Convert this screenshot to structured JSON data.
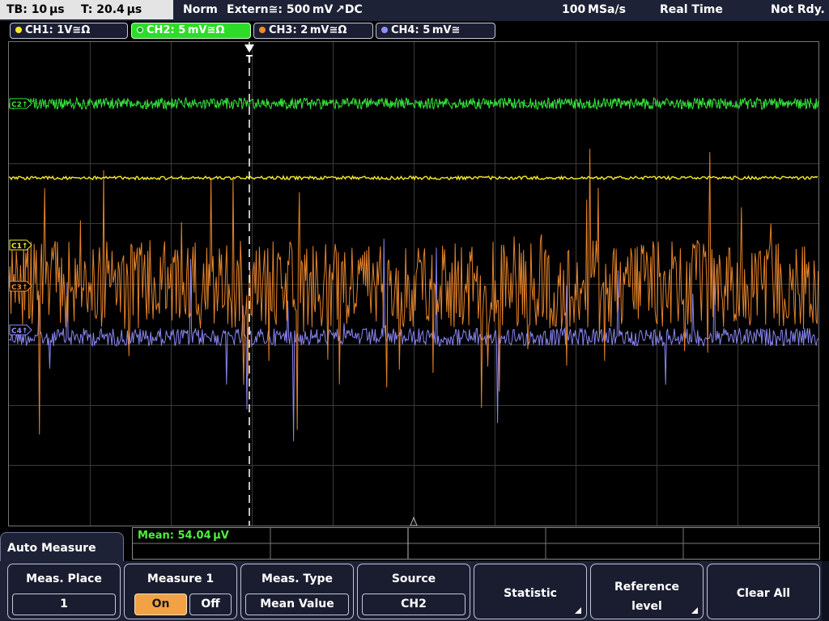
{
  "status": {
    "timebase": "TB: 10 µs",
    "trigger_time": "T: 20.4 µs",
    "mode": "Norm",
    "trigger": "Extern≅: 500 mV ↗DC",
    "sample_rate": "100 MSa/s",
    "acq_mode": "Real Time",
    "state": "Not Rdy."
  },
  "channels": [
    {
      "label": "CH1: 1V≅Ω",
      "color": "#f4ea2c"
    },
    {
      "label": "CH2: 5 mV≅Ω",
      "color": "#34e63a",
      "active": true
    },
    {
      "label": "CH3: 2 mV≅Ω",
      "color": "#f08a2c"
    },
    {
      "label": "CH4: 5 mV≅",
      "color": "#8f8dff"
    }
  ],
  "markers": {
    "ch1": "C1↑",
    "ch2": "C2↑",
    "ch3": "C3↑",
    "ch4": "C4↑",
    "trigger": "T"
  },
  "measurement": {
    "readout": "Mean: 54.04 µV"
  },
  "menu": {
    "title": "Auto Measure",
    "meas_place": {
      "label": "Meas. Place",
      "value": "1"
    },
    "measure1": {
      "label": "Measure 1",
      "on": "On",
      "off": "Off"
    },
    "meas_type": {
      "label": "Meas. Type",
      "value": "Mean Value"
    },
    "source": {
      "label": "Source",
      "value": "CH2"
    },
    "statistic": {
      "label": "Statistic"
    },
    "reference": {
      "line1": "Reference",
      "line2": "level"
    },
    "clear_all": {
      "label": "Clear All"
    }
  }
}
